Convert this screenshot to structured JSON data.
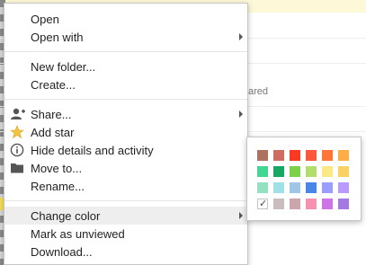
{
  "menu": {
    "open": "Open",
    "open_with": "Open with",
    "new_folder": "New folder...",
    "create": "Create...",
    "share": "Share...",
    "add_star": "Add star",
    "hide_details": "Hide details and activity",
    "move_to": "Move to...",
    "rename": "Rename...",
    "change_color": "Change color",
    "mark_unviewed": "Mark as unviewed",
    "download": "Download..."
  },
  "background": {
    "partial_text": "ared"
  },
  "palette": {
    "selected_index": 18,
    "colors": [
      "#ac725e",
      "#d06b64",
      "#f83a22",
      "#fa573c",
      "#ff7537",
      "#ffad46",
      "#42d692",
      "#16a765",
      "#7bd148",
      "#b3dc6c",
      "#fbe983",
      "#fad165",
      "#92e1c0",
      "#9fe1e7",
      "#9fc6e7",
      "#4986e7",
      "#9a9cff",
      "#b99aff",
      "#c2c2c2",
      "#cabdbf",
      "#cca6ac",
      "#f691b2",
      "#cd74e6",
      "#a47ae2"
    ]
  }
}
